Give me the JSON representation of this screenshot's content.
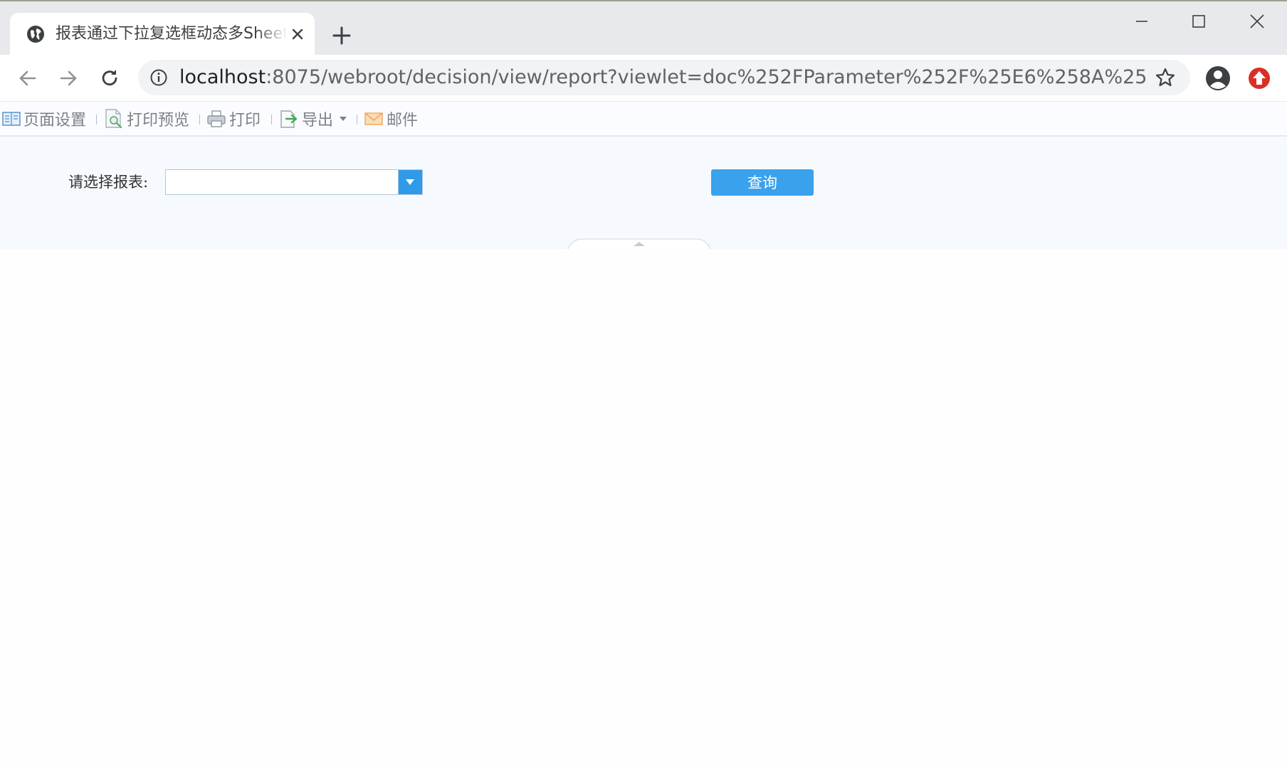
{
  "browser": {
    "tab": {
      "title": "报表通过下拉复选框动态多Sheet"
    },
    "url": {
      "host": "localhost",
      "rest": ":8075/webroot/decision/view/report?viewlet=doc%252FParameter%252F%25E6%258A%25A5%25E8..."
    }
  },
  "toolbar": {
    "items": [
      {
        "label": "页面设置",
        "icon": "page-setup-icon"
      },
      {
        "label": "打印预览",
        "icon": "print-preview-icon"
      },
      {
        "label": "打印",
        "icon": "print-icon"
      },
      {
        "label": "导出",
        "icon": "export-icon"
      },
      {
        "label": "邮件",
        "icon": "mail-icon"
      }
    ]
  },
  "params": {
    "label": "请选择报表:",
    "combo": {
      "value": ""
    },
    "query_label": "查询"
  },
  "colors": {
    "accent": "#3aa1ec",
    "combo_trigger": "#2f9be8",
    "update_badge": "#d93025"
  }
}
